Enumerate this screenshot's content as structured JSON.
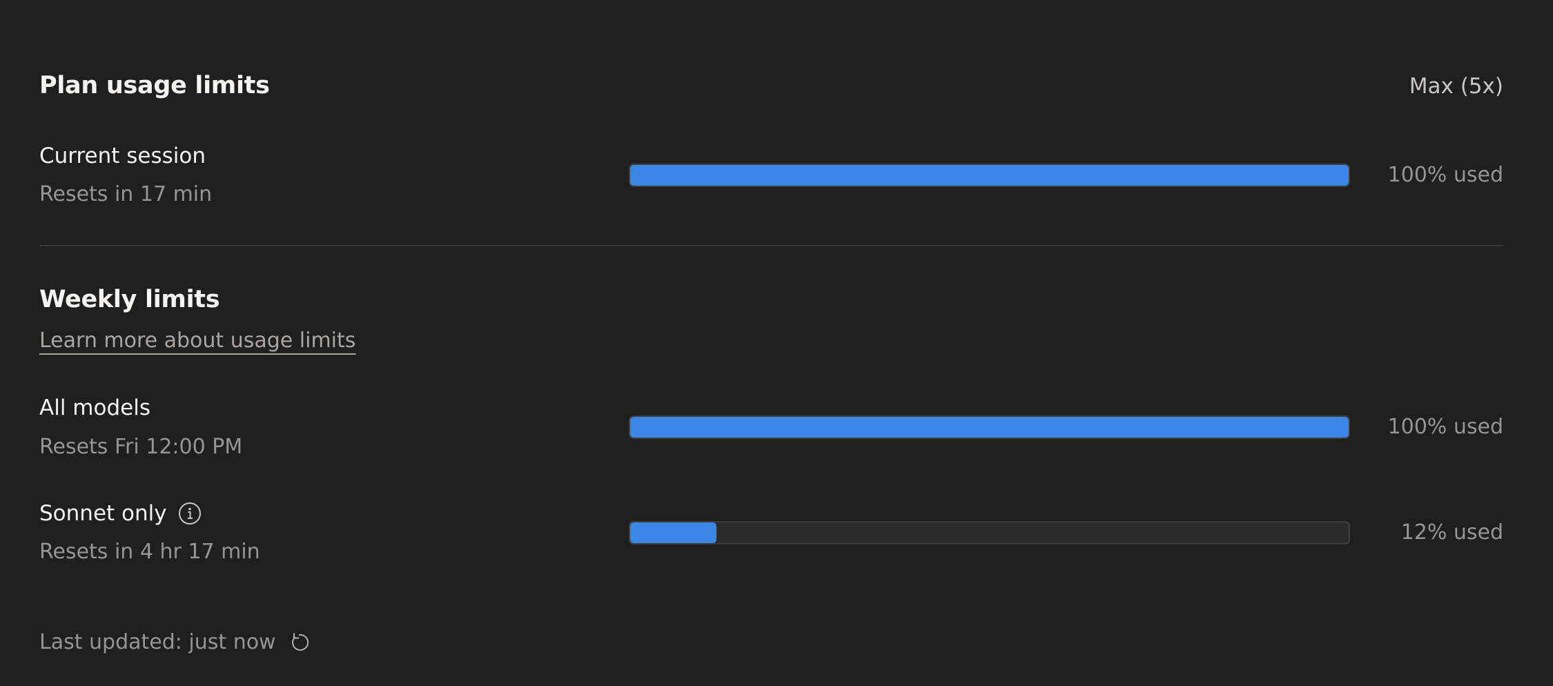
{
  "plan": {
    "title": "Plan usage limits",
    "tier": "Max (5x)"
  },
  "current_session": {
    "label": "Current session",
    "reset": "Resets in 17 min",
    "usage_text": "100% used",
    "used_fraction": 1.0
  },
  "weekly": {
    "title": "Weekly limits",
    "learn_more": "Learn more about usage limits",
    "all_models": {
      "label": "All models",
      "reset": "Resets Fri 12:00 PM",
      "usage_text": "100% used",
      "used_fraction": 1.0
    },
    "sonnet_only": {
      "label": "Sonnet only",
      "info_icon": "info-icon",
      "reset": "Resets in 4 hr 17 min",
      "usage_text": "12% used",
      "used_fraction": 0.12
    }
  },
  "footer": {
    "last_updated": "Last updated: just now",
    "refresh_icon": "refresh-icon"
  },
  "colors": {
    "background": "#1f1f1e",
    "bar_fill": "#3b86e6",
    "bar_track": "#2c2c2a",
    "text_primary": "#f5f4ef",
    "text_secondary": "#97958f"
  }
}
